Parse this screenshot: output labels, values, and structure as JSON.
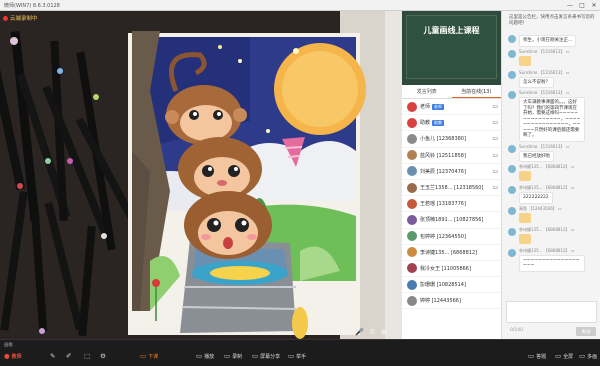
{
  "window": {
    "title": "微师(WIN7) 8.6.3.0128",
    "controls": [
      "—",
      "□",
      "✕"
    ]
  },
  "video": {
    "recording_label": "云端录制中",
    "controls": [
      "🎤",
      "⧉",
      "▣",
      "⤢"
    ]
  },
  "class_panel": {
    "board_title": "儿童画线上课程",
    "tabs": [
      "发言列表",
      "当前在线(13)"
    ],
    "users": [
      {
        "name": "老师",
        "badge": "老师",
        "device": "▭",
        "avatar_color": "#d94040"
      },
      {
        "name": "助教",
        "badge": "助教",
        "device": "▭",
        "avatar_color": "#d94040"
      },
      {
        "name": "小鱼儿 [12368380]",
        "badge": "",
        "device": "▭",
        "avatar_color": "#8a8a8a"
      },
      {
        "name": "蓝风铃 [12511858]",
        "badge": "",
        "device": "▭",
        "avatar_color": "#b08050"
      },
      {
        "name": "刘美辰 [12370476]",
        "badge": "",
        "device": "▭",
        "avatar_color": "#6a8fb0"
      },
      {
        "name": "王玉兰1358... [12318560]",
        "badge": "",
        "device": "▭",
        "avatar_color": "#9b6a4a"
      },
      {
        "name": "王若瑶 [13183776]",
        "badge": "",
        "device": "",
        "avatar_color": "#c45a3a"
      },
      {
        "name": "张顶楠1891... [10827856]",
        "badge": "",
        "device": "",
        "avatar_color": "#7a5a9a"
      },
      {
        "name": "包婷婷 [12364550]",
        "badge": "",
        "device": "",
        "avatar_color": "#5a9a6a"
      },
      {
        "name": "李诗婕135... [6868812]",
        "badge": "",
        "device": "",
        "avatar_color": "#d08a40"
      },
      {
        "name": "我冷女王 [11005866]",
        "badge": "",
        "device": "",
        "avatar_color": "#a04050"
      },
      {
        "name": "彭珊珊 [10828514]",
        "badge": "",
        "device": "",
        "avatar_color": "#4a7ab0"
      },
      {
        "name": "婷婷 [12443566]",
        "badge": "",
        "device": "",
        "avatar_color": "#888888"
      }
    ]
  },
  "chat": {
    "notice": "这里是公告栏，快用点击发言条来书写您的问题吧！",
    "messages": [
      {
        "who": "",
        "text": "师生，小现在刚关注正...",
        "sticker": false
      },
      {
        "who": "Sunshine 【1316613】 ▭",
        "text": "",
        "sticker": true
      },
      {
        "who": "Sunshine 【1316613】 ▭",
        "text": "怎么不说啦？",
        "sticker": false
      },
      {
        "who": "Sunshine 【1316613】 ▭",
        "text": "大车满教事课面的。。。这好了吗？我们的第四节课现在开始，需要这样吗~~~~~~~~~~~~~~~，~~~~~~~~~~~~~~~~，~~~~~只然好的课后都还需要啊了。",
        "sticker": false
      },
      {
        "who": "Sunshine 【1316613】 ▭",
        "text": "我已经放好啦",
        "sticker": false
      },
      {
        "who": "李诗婕135... 【6868812】 ▭",
        "text": "",
        "sticker": true
      },
      {
        "who": "李诗婕135... 【6868812】 ▭",
        "text": "222222222",
        "sticker": false
      },
      {
        "who": "高鱼 【12443566】 ▭",
        "text": "",
        "sticker": true
      },
      {
        "who": "李诗婕135... 【6868812】 ▭",
        "text": "",
        "sticker": true
      },
      {
        "who": "李诗婕135... 【6868812】 ▭",
        "text": "~~~~~~~~~~~~~~~~~~",
        "sticker": false
      }
    ],
    "count": "0/140",
    "send": "发送"
  },
  "toolbar": {
    "top_text": "画板",
    "role": {
      "icon": "●",
      "label": "教师"
    },
    "icons": [
      {
        "icon": "✎",
        "label": ""
      },
      {
        "icon": "✐",
        "label": ""
      },
      {
        "icon": "⬚",
        "label": ""
      },
      {
        "icon": "⚙",
        "label": ""
      }
    ],
    "actions": [
      {
        "icon": "▭",
        "label": "下课"
      },
      {
        "icon": "▭",
        "label": "播放"
      },
      {
        "icon": "▭",
        "label": "录制"
      },
      {
        "icon": "▭",
        "label": "屏幕分享"
      },
      {
        "icon": "▭",
        "label": "举手"
      }
    ],
    "right": [
      {
        "icon": "▭",
        "label": "答题"
      },
      {
        "icon": "▭",
        "label": "全屏"
      },
      {
        "icon": "▭",
        "label": "多画"
      }
    ]
  }
}
